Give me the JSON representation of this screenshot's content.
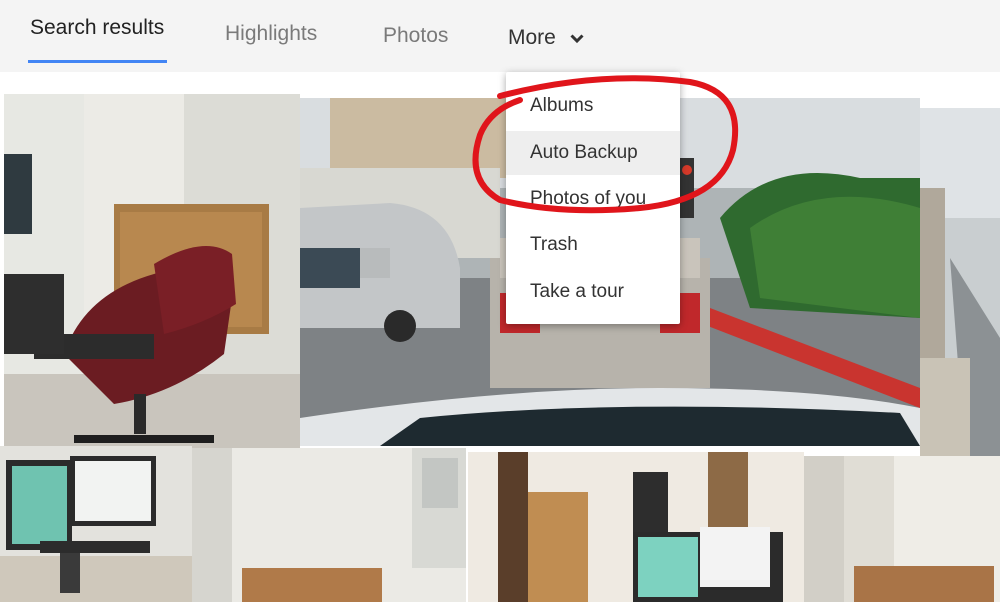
{
  "tabs": {
    "search_results": "Search results",
    "highlights": "Highlights",
    "photos": "Photos",
    "more": "More"
  },
  "menu": {
    "items": [
      {
        "label": "Albums"
      },
      {
        "label": "Auto Backup"
      },
      {
        "label": "Photos of you"
      },
      {
        "label": "Trash"
      },
      {
        "label": "Take a tour"
      }
    ]
  },
  "photos": [
    {
      "name": "office-chair-photo"
    },
    {
      "name": "street-car-photo"
    },
    {
      "name": "city-view-photo"
    },
    {
      "name": "desk-monitors-photo"
    },
    {
      "name": "room-corner-photo"
    },
    {
      "name": "bookshelf-desk-photo"
    },
    {
      "name": "doorway-photo"
    }
  ],
  "colors": {
    "accent_underline": "#4285f4",
    "annotation_red": "#e0151b"
  }
}
